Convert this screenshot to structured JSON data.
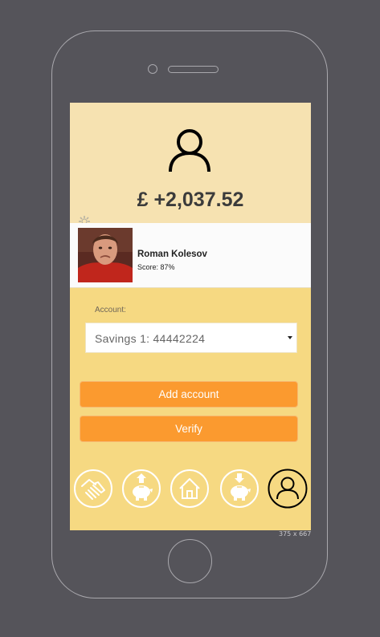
{
  "device": {
    "viewport_label": "375 x 667"
  },
  "header": {
    "balance": "£ +2,037.52"
  },
  "profile": {
    "name": "Roman Kolesov",
    "score": "Score: 87%"
  },
  "account": {
    "label": "Account:",
    "selected": "Savings 1:  44442224"
  },
  "buttons": {
    "add_account": "Add account",
    "verify": "Verify"
  },
  "nav": [
    "handshake-icon",
    "piggy-bank-deposit-icon",
    "home-icon",
    "piggy-bank-withdraw-icon",
    "user-icon"
  ],
  "colors": {
    "accent": "#fb9a2f",
    "screen_bg": "#f6d982",
    "header_bg": "#f6e2b1",
    "device_bg": "#55545a"
  }
}
